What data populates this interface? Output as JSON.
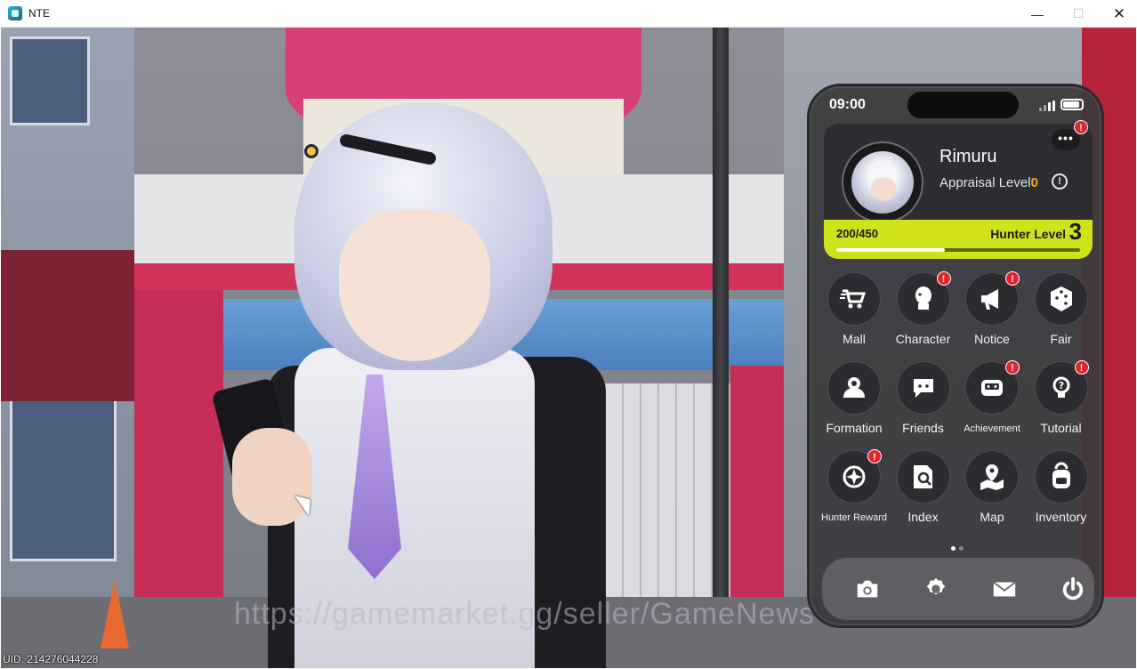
{
  "window": {
    "title": "NTE",
    "minimize_glyph": "—",
    "maximize_glyph": "☐",
    "close_glyph": "✕"
  },
  "overlay": {
    "uid": "UID: 214276044228",
    "watermark": "https://gamemarket.gg/seller/GameNews"
  },
  "phone": {
    "time": "09:00",
    "profile": {
      "name": "Rimuru",
      "appraisal_label": "Appraisal Level",
      "appraisal_value": "0",
      "info_glyph": "!",
      "more_glyph": "•••",
      "xp_text": "200/450",
      "xp_progress": 0.444,
      "hunter_level_label": "Hunter Level",
      "hunter_level_value": "3",
      "alert": "!"
    },
    "apps": [
      {
        "label": "Mall",
        "icon": "cart-icon",
        "badge": ""
      },
      {
        "label": "Character",
        "icon": "character-icon",
        "badge": "!"
      },
      {
        "label": "Notice",
        "icon": "megaphone-icon",
        "badge": "!"
      },
      {
        "label": "Fair",
        "icon": "dice-icon",
        "badge": ""
      },
      {
        "label": "Formation",
        "icon": "formation-icon",
        "badge": ""
      },
      {
        "label": "Friends",
        "icon": "chat-icon",
        "badge": ""
      },
      {
        "label": "Achievement",
        "icon": "robot-icon",
        "badge": "!"
      },
      {
        "label": "Tutorial",
        "icon": "lightbulb-icon",
        "badge": "!"
      },
      {
        "label": "Hunter Reward",
        "icon": "crosshair-icon",
        "badge": "!"
      },
      {
        "label": "Index",
        "icon": "index-search-icon",
        "badge": ""
      },
      {
        "label": "Map",
        "icon": "map-pin-icon",
        "badge": ""
      },
      {
        "label": "Inventory",
        "icon": "backpack-icon",
        "badge": ""
      }
    ],
    "page_indicator": {
      "current": 1,
      "total": 2
    },
    "dock": [
      "camera-icon",
      "settings-icon",
      "mail-icon",
      "power-icon"
    ],
    "colors": {
      "accent": "#cfe21a",
      "badge": "#e3232e",
      "appraisal": "#f4b21c"
    }
  }
}
